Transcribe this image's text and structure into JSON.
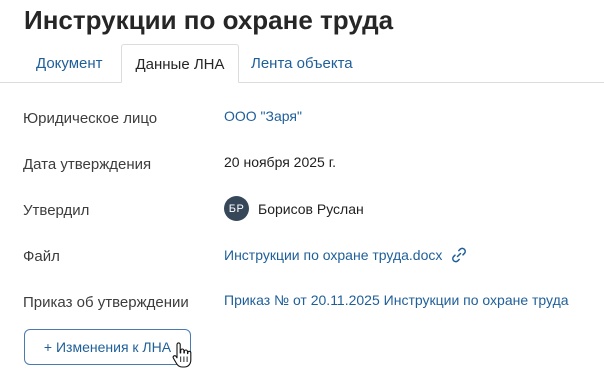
{
  "page": {
    "title": "Инструкции по охране труда"
  },
  "tabs": [
    {
      "label": "Документ",
      "active": false
    },
    {
      "label": "Данные ЛНА",
      "active": true
    },
    {
      "label": "Лента объекта",
      "active": false
    }
  ],
  "fields": {
    "legal_entity": {
      "label": "Юридическое лицо",
      "value": "ООО \"Заря\""
    },
    "approval_date": {
      "label": "Дата утверждения",
      "value": "20 ноября 2025 г."
    },
    "approved_by": {
      "label": "Утвердил",
      "initials": "БР",
      "name": "Борисов Руслан"
    },
    "file": {
      "label": "Файл",
      "value": "Инструкции по охране труда.docx",
      "icon": "link-icon"
    },
    "order": {
      "label": "Приказ об утверждении",
      "value": "Приказ № от 20.11.2025 Инструкции по охране труда"
    }
  },
  "actions": {
    "add_changes_label": "+ Изменения к ЛНА"
  },
  "colors": {
    "link": "#1f5f99",
    "avatar_bg": "#37475a",
    "button_border": "#4a7bb0"
  }
}
